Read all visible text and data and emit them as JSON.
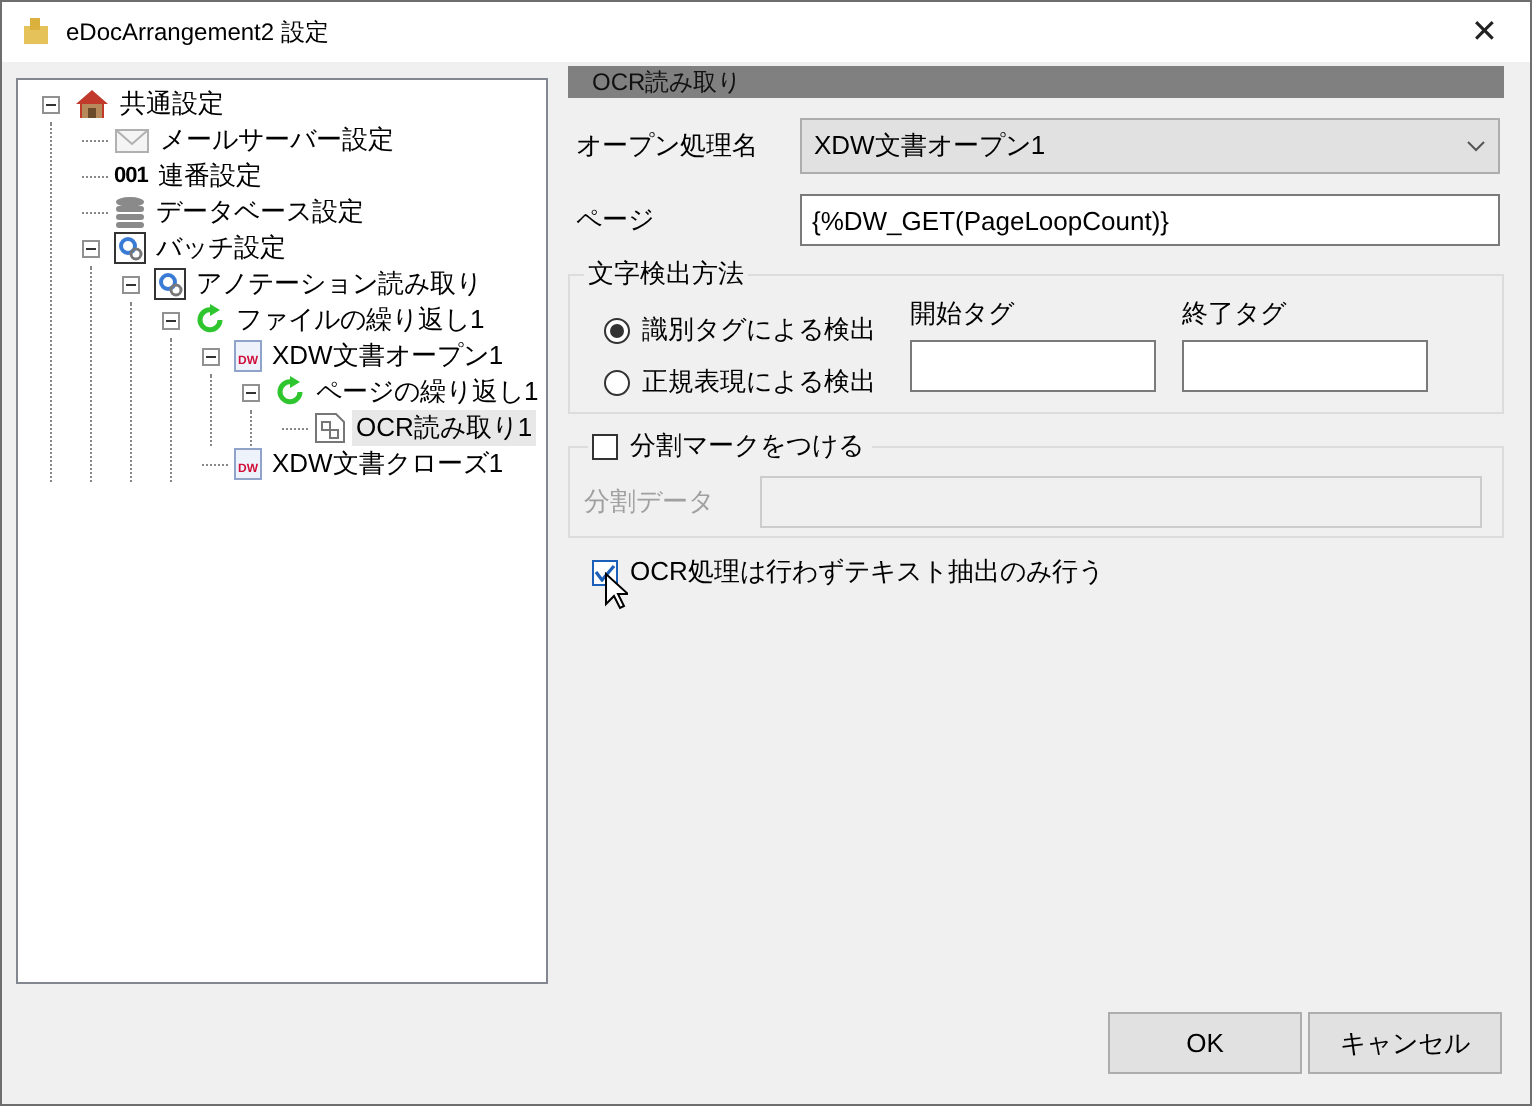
{
  "window": {
    "title": "eDocArrangement2 設定",
    "close": "✕"
  },
  "tree": [
    {
      "label": "共通設定",
      "kind": "house",
      "expanded": true,
      "selected": false,
      "children": [
        {
          "label": "メールサーバー設定",
          "kind": "mail",
          "selected": false
        },
        {
          "label": "連番設定",
          "kind": "counter",
          "icon_text": "001",
          "selected": false
        },
        {
          "label": "データベース設定",
          "kind": "database",
          "selected": false
        },
        {
          "label": "バッチ設定",
          "kind": "gear",
          "expanded": true,
          "selected": false,
          "children": [
            {
              "label": "アノテーション読み取り",
              "kind": "gear",
              "expanded": true,
              "selected": false,
              "children": [
                {
                  "label": "ファイルの繰り返し1",
                  "kind": "loop",
                  "expanded": true,
                  "selected": false,
                  "children": [
                    {
                      "label": "XDW文書オープン1",
                      "kind": "doc",
                      "icon_text": "DW",
                      "expanded": true,
                      "selected": false,
                      "children": [
                        {
                          "label": "ページの繰り返し1",
                          "kind": "loop",
                          "expanded": true,
                          "selected": false,
                          "children": [
                            {
                              "label": "OCR読み取り1",
                              "kind": "ocr",
                              "selected": true
                            }
                          ]
                        }
                      ]
                    },
                    {
                      "label": "XDW文書クローズ1",
                      "kind": "doc",
                      "icon_text": "DW",
                      "selected": false
                    }
                  ]
                }
              ]
            }
          ]
        }
      ]
    }
  ],
  "panel": {
    "header": "OCR読み取り",
    "open_name": {
      "label": "オープン処理名",
      "value": "XDW文書オープン1"
    },
    "page": {
      "label": "ページ",
      "value": "{%DW_GET(PageLoopCount)}"
    },
    "detection": {
      "title": "文字検出方法",
      "options": [
        {
          "label": "識別タグによる検出",
          "selected": true
        },
        {
          "label": "正規表現による検出",
          "selected": false
        }
      ],
      "start_tag": {
        "label": "開始タグ"
      },
      "end_tag": {
        "label": "終了タグ"
      }
    },
    "split": {
      "label": "分割マークをつける",
      "checked": false,
      "data_label": "分割データ",
      "disabled": true
    },
    "text_only": {
      "label": "OCR処理は行わずテキスト抽出のみ行う",
      "checked": true
    }
  },
  "buttons": [
    "OK",
    "キャンセル"
  ]
}
